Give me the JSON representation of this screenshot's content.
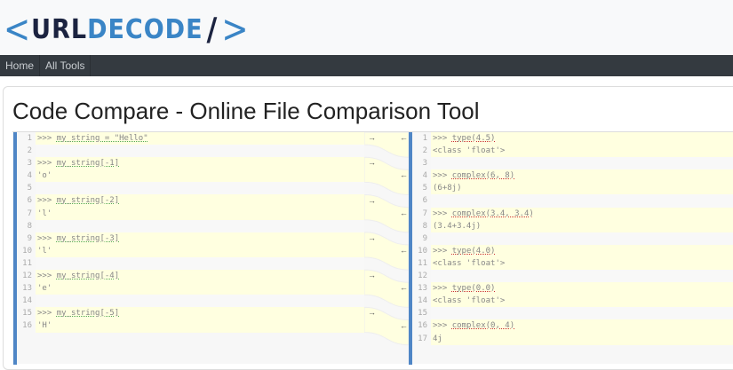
{
  "logo": {
    "left": "<",
    "url": "URL",
    "decode": "DECODE",
    "slash": "/",
    "right": ">"
  },
  "nav": [
    {
      "label": "Home"
    },
    {
      "label": "All Tools"
    }
  ],
  "title": "Code Compare - Online File Comparison Tool",
  "left_lines": [
    "1|>>> my_string = \"Hello\"|c",
    "2||b",
    "3|>>> my_string[-1]|c",
    "4|'o'|c",
    "5||b",
    "6|>>> my_string[-2]|c",
    "7|'l'|c",
    "8||b",
    "9|>>> my_string[-3]|c",
    "10|'l'|c",
    "11||b",
    "12|>>> my_string[-4]|c",
    "13|'e'|c",
    "14||b",
    "15|>>> my_string[-5]|c",
    "16|'H'|c"
  ],
  "right_lines": [
    "1|>>> type(4.5)|c",
    "2|<class 'float'>|c",
    "3||b",
    "4|>>> complex(6, 8)|c",
    "5|(6+8j)|c",
    "6||b",
    "7|>>> complex(3.4, 3.4)|c",
    "8|(3.4+3.4j)|c",
    "9||b",
    "10|>>> type(4.0)|c",
    "11|<class 'float'>|c",
    "12||b",
    "13|>>> type(0.0)|c",
    "14|<class 'float'>|c",
    "15||b",
    "16|>>> complex(0, 4)|c",
    "17|4j|c"
  ],
  "arrows": {
    "right": "→",
    "left": "←"
  }
}
